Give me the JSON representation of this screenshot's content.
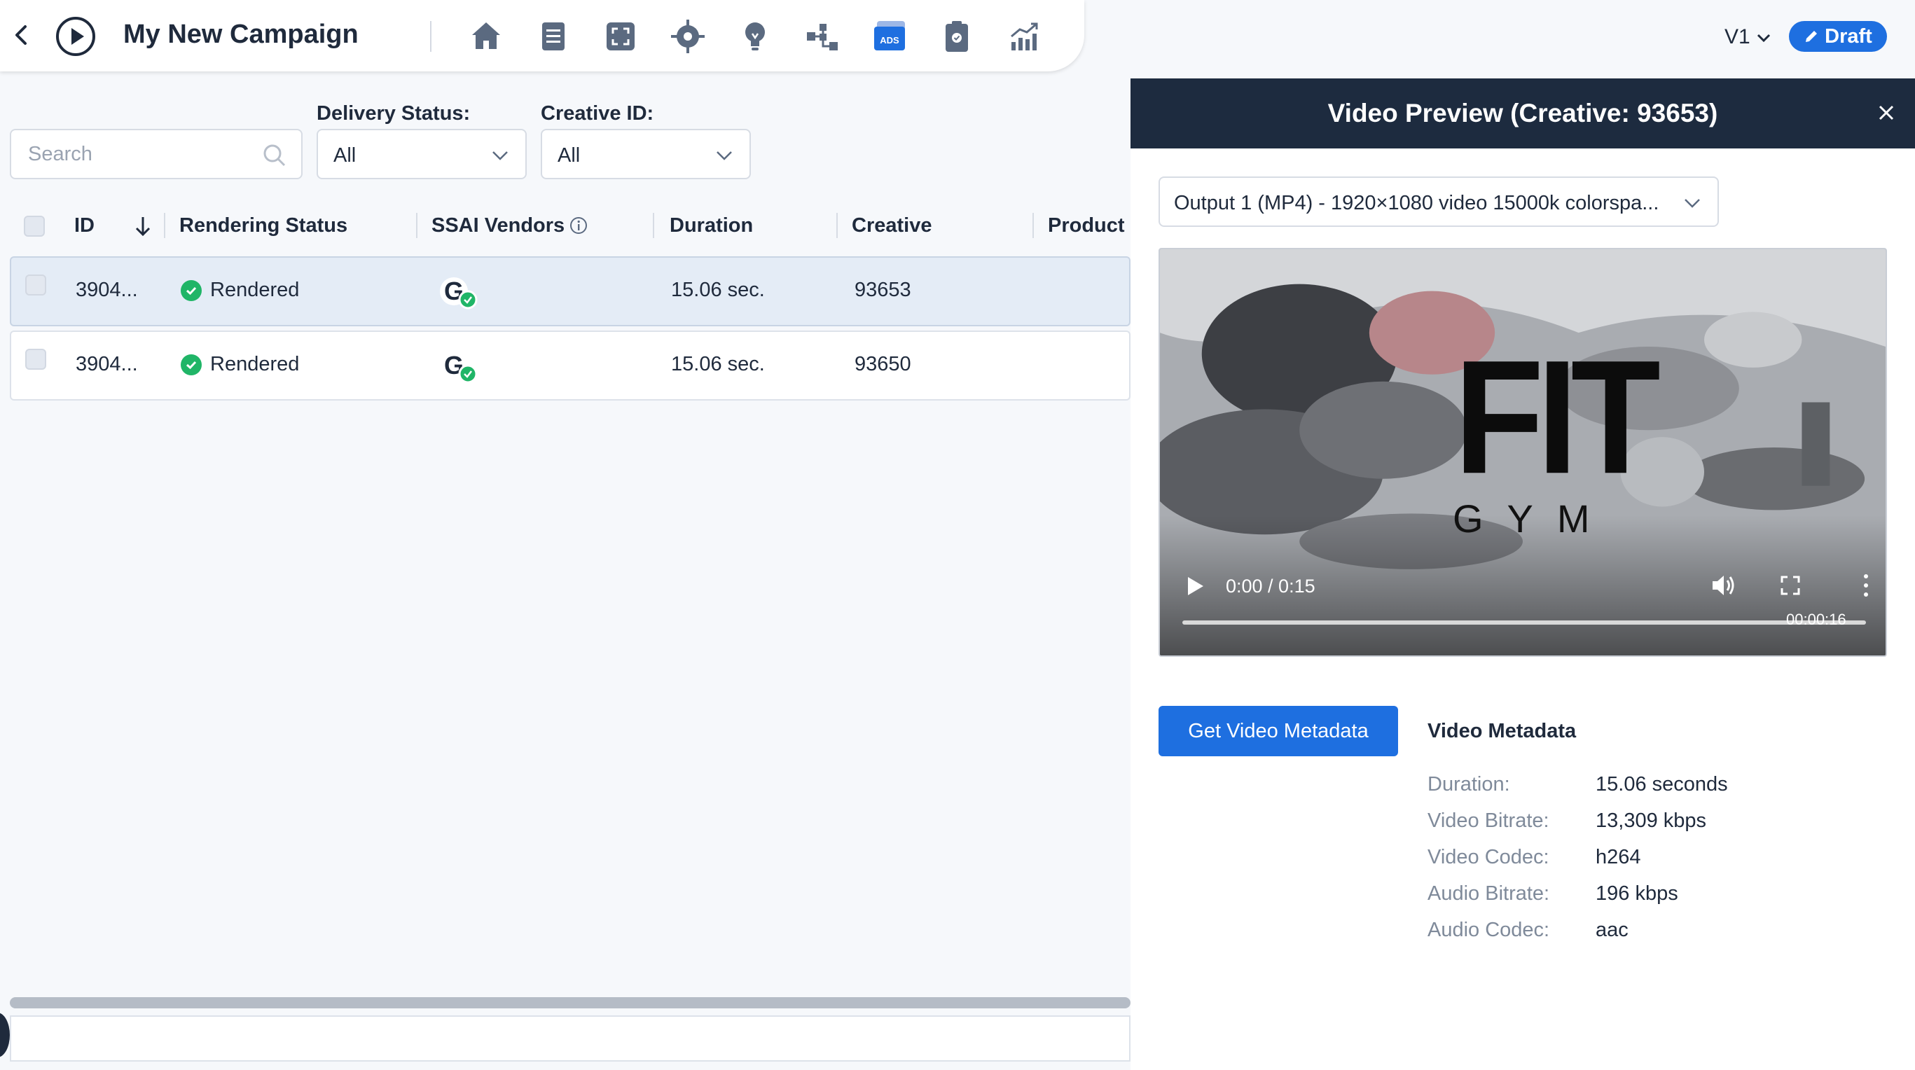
{
  "header": {
    "campaign_title": "My New Campaign",
    "version": "V1",
    "draft_label": "Draft",
    "nav_icons": [
      "home-icon",
      "document-icon",
      "frame-icon",
      "target-icon",
      "lightbulb-icon",
      "hierarchy-icon",
      "ads-icon",
      "clipboard-icon",
      "analytics-icon"
    ],
    "ads_badge": "ADS",
    "accent_color": "#1e6fe0"
  },
  "filters": {
    "search_placeholder": "Search",
    "delivery_status_label": "Delivery Status:",
    "delivery_status_value": "All",
    "creative_id_label": "Creative ID:",
    "creative_id_value": "All"
  },
  "table": {
    "columns": [
      "ID",
      "Rendering Status",
      "SSAI Vendors",
      "Duration",
      "Creative",
      "Product"
    ],
    "rows": [
      {
        "id": "3904...",
        "status": "Rendered",
        "vendor": "G",
        "duration": "15.06 sec.",
        "creative": "93653",
        "selected": true
      },
      {
        "id": "3904...",
        "status": "Rendered",
        "vendor": "G",
        "duration": "15.06 sec.",
        "creative": "93650",
        "selected": false
      }
    ]
  },
  "panel": {
    "title": "Video Preview (Creative: 93653)",
    "output_option": "Output 1 (MP4) - 1920×1080 video 15000k colorspa...",
    "video": {
      "logo_main": "FIT",
      "logo_sub": "GYM",
      "time": "0:00 / 0:15",
      "stamp": "00:00:16",
      "progress": 0
    },
    "metadata_button": "Get Video Metadata",
    "metadata_title": "Video Metadata",
    "metadata": [
      {
        "key": "Duration:",
        "value": "15.06 seconds"
      },
      {
        "key": "Video Bitrate:",
        "value": "13,309 kbps"
      },
      {
        "key": "Video Codec:",
        "value": "h264"
      },
      {
        "key": "Audio Bitrate:",
        "value": "196 kbps"
      },
      {
        "key": "Audio Codec:",
        "value": "aac"
      }
    ]
  }
}
